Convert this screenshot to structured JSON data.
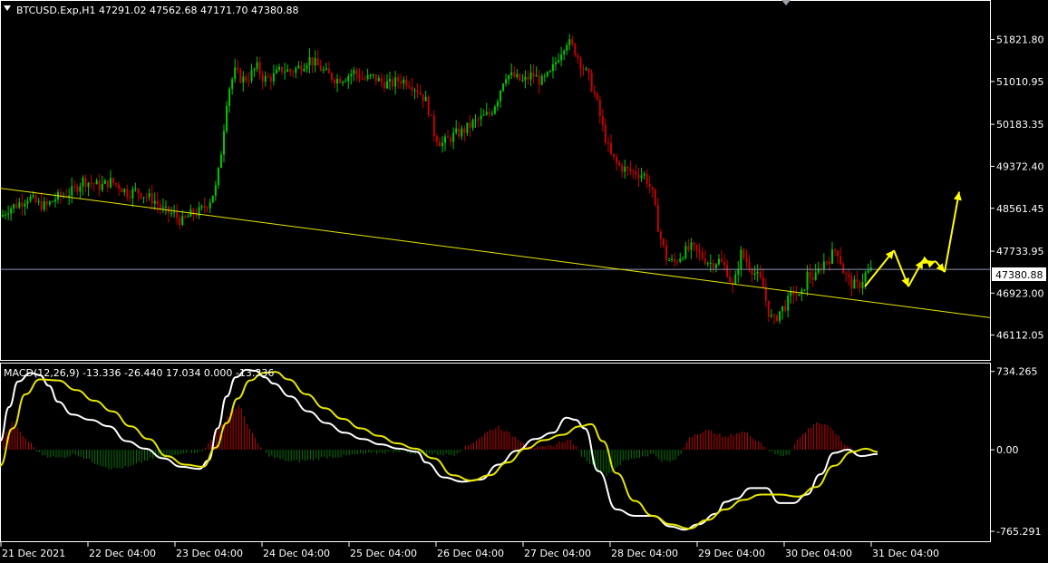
{
  "header": {
    "symbol_line": "BTCUSD.Exp,H1  47291.02 47562.68 47171.70 47380.88",
    "macd_line": "MACD(12,26,9) -13.336 -26.440 17.034 0.000 -13.336"
  },
  "colors": {
    "background": "#000000",
    "frame": "#ffffff",
    "bull_candle": "#00c800",
    "bear_candle": "#c80000",
    "trendline": "#e6e600",
    "forecast_arrow": "#ffff00",
    "price_line": "#8c96b4",
    "macd_line": "#ffffff",
    "signal_line": "#e6e600",
    "hist_pos": "#c80000",
    "hist_neg": "#007800"
  },
  "chart_data": {
    "type": "candlestick",
    "symbol": "BTCUSD.Exp",
    "timeframe": "H1",
    "ohlc_last": {
      "open": 47291.02,
      "high": 47562.68,
      "low": 47171.7,
      "close": 47380.88
    },
    "price_ticks": [
      "51821.80",
      "51010.95",
      "50183.35",
      "49372.40",
      "48561.45",
      "47733.95",
      "46923.00",
      "46112.05"
    ],
    "price_tick_values": [
      51821.8,
      51010.95,
      50183.35,
      49372.4,
      48561.45,
      47733.95,
      46923.0,
      46112.05
    ],
    "current_price_label": "47380.88",
    "current_price": 47380.88,
    "ylim": [
      45650,
      52550
    ],
    "time_labels": [
      "21 Dec 2021",
      "22 Dec 04:00",
      "23 Dec 04:00",
      "24 Dec 04:00",
      "25 Dec 04:00",
      "26 Dec 04:00",
      "27 Dec 04:00",
      "28 Dec 04:00",
      "29 Dec 04:00",
      "30 Dec 04:00",
      "31 Dec 04:00"
    ],
    "price_path": [
      [
        0,
        48400
      ],
      [
        8,
        48550
      ],
      [
        16,
        48620
      ],
      [
        24,
        48700
      ],
      [
        30,
        48780
      ],
      [
        40,
        48650
      ],
      [
        50,
        48600
      ],
      [
        60,
        48750
      ],
      [
        70,
        48820
      ],
      [
        80,
        48900
      ],
      [
        90,
        49100
      ],
      [
        100,
        49050
      ],
      [
        110,
        48980
      ],
      [
        120,
        49080
      ],
      [
        130,
        49000
      ],
      [
        140,
        48850
      ],
      [
        150,
        48900
      ],
      [
        160,
        48800
      ],
      [
        170,
        48700
      ],
      [
        180,
        48500
      ],
      [
        190,
        48450
      ],
      [
        200,
        48300
      ],
      [
        210,
        48450
      ],
      [
        220,
        48500
      ],
      [
        230,
        48700
      ],
      [
        238,
        49000
      ],
      [
        244,
        49800
      ],
      [
        250,
        50800
      ],
      [
        258,
        51200
      ],
      [
        266,
        51050
      ],
      [
        274,
        51100
      ],
      [
        282,
        51300
      ],
      [
        290,
        51050
      ],
      [
        300,
        51100
      ],
      [
        310,
        51250
      ],
      [
        320,
        51200
      ],
      [
        330,
        51300
      ],
      [
        340,
        51450
      ],
      [
        350,
        51300
      ],
      [
        360,
        51150
      ],
      [
        370,
        51050
      ],
      [
        380,
        51100
      ],
      [
        390,
        51200
      ],
      [
        400,
        51050
      ],
      [
        410,
        51100
      ],
      [
        420,
        51000
      ],
      [
        430,
        50950
      ],
      [
        440,
        51050
      ],
      [
        450,
        51000
      ],
      [
        460,
        50850
      ],
      [
        470,
        50600
      ],
      [
        478,
        50000
      ],
      [
        486,
        49800
      ],
      [
        494,
        49900
      ],
      [
        502,
        50000
      ],
      [
        510,
        50050
      ],
      [
        520,
        50200
      ],
      [
        530,
        50300
      ],
      [
        540,
        50400
      ],
      [
        548,
        50700
      ],
      [
        556,
        51150
      ],
      [
        566,
        51100
      ],
      [
        576,
        51000
      ],
      [
        586,
        51150
      ],
      [
        596,
        51000
      ],
      [
        606,
        51150
      ],
      [
        616,
        51550
      ],
      [
        624,
        51800
      ],
      [
        632,
        51650
      ],
      [
        640,
        51350
      ],
      [
        648,
        51100
      ],
      [
        656,
        50700
      ],
      [
        664,
        50100
      ],
      [
        672,
        49600
      ],
      [
        680,
        49400
      ],
      [
        690,
        49300
      ],
      [
        700,
        49250
      ],
      [
        710,
        49200
      ],
      [
        718,
        48900
      ],
      [
        726,
        48100
      ],
      [
        734,
        47600
      ],
      [
        742,
        47500
      ],
      [
        752,
        47700
      ],
      [
        762,
        47800
      ],
      [
        772,
        47650
      ],
      [
        782,
        47500
      ],
      [
        792,
        47550
      ],
      [
        800,
        47400
      ],
      [
        808,
        47000
      ],
      [
        816,
        47700
      ],
      [
        824,
        47500
      ],
      [
        832,
        47300
      ],
      [
        840,
        47100
      ],
      [
        846,
        46600
      ],
      [
        852,
        46350
      ],
      [
        858,
        46550
      ],
      [
        866,
        46700
      ],
      [
        874,
        46950
      ],
      [
        882,
        46800
      ],
      [
        890,
        47300
      ],
      [
        898,
        47200
      ],
      [
        906,
        47500
      ],
      [
        914,
        47600
      ],
      [
        922,
        47800
      ],
      [
        930,
        47300
      ],
      [
        938,
        47100
      ],
      [
        946,
        47050
      ],
      [
        954,
        47300
      ],
      [
        962,
        47380
      ]
    ],
    "trendline": {
      "from": [
        0,
        48950
      ],
      "to": [
        1092,
        46450
      ]
    },
    "forecast_path": [
      [
        954,
        47050
      ],
      [
        986,
        47750
      ],
      [
        1002,
        47050
      ],
      [
        1018,
        47560
      ],
      [
        1026,
        47500
      ],
      [
        1032,
        47540
      ],
      [
        1042,
        47330
      ],
      [
        1058,
        48880
      ]
    ],
    "macd": {
      "label": "MACD(12,26,9)",
      "values": {
        "main": -13.336,
        "signal": -26.44,
        "histogram": 17.034,
        "zero": 0.0,
        "last": -13.336
      },
      "ticks": [
        "734.265",
        "0.00",
        "-765.291"
      ],
      "tick_values": [
        734.265,
        0.0,
        -765.291
      ],
      "ylim": [
        -850,
        800
      ],
      "main": [
        [
          0,
          80
        ],
        [
          10,
          400
        ],
        [
          20,
          640
        ],
        [
          34,
          720
        ],
        [
          44,
          700
        ],
        [
          54,
          600
        ],
        [
          64,
          450
        ],
        [
          80,
          330
        ],
        [
          100,
          280
        ],
        [
          120,
          220
        ],
        [
          140,
          80
        ],
        [
          160,
          10
        ],
        [
          180,
          -80
        ],
        [
          200,
          -160
        ],
        [
          220,
          -180
        ],
        [
          230,
          -100
        ],
        [
          240,
          200
        ],
        [
          250,
          500
        ],
        [
          260,
          680
        ],
        [
          272,
          750
        ],
        [
          282,
          740
        ],
        [
          292,
          680
        ],
        [
          302,
          620
        ],
        [
          320,
          500
        ],
        [
          340,
          360
        ],
        [
          360,
          250
        ],
        [
          380,
          160
        ],
        [
          400,
          100
        ],
        [
          420,
          50
        ],
        [
          440,
          10
        ],
        [
          460,
          -20
        ],
        [
          470,
          -120
        ],
        [
          490,
          -260
        ],
        [
          510,
          -300
        ],
        [
          530,
          -280
        ],
        [
          550,
          -140
        ],
        [
          570,
          -10
        ],
        [
          590,
          100
        ],
        [
          610,
          160
        ],
        [
          625,
          300
        ],
        [
          635,
          280
        ],
        [
          645,
          200
        ],
        [
          660,
          -200
        ],
        [
          680,
          -560
        ],
        [
          700,
          -620
        ],
        [
          720,
          -620
        ],
        [
          740,
          -720
        ],
        [
          755,
          -750
        ],
        [
          770,
          -700
        ],
        [
          790,
          -600
        ],
        [
          800,
          -490
        ],
        [
          812,
          -460
        ],
        [
          828,
          -360
        ],
        [
          845,
          -360
        ],
        [
          860,
          -500
        ],
        [
          875,
          -500
        ],
        [
          890,
          -420
        ],
        [
          905,
          -230
        ],
        [
          920,
          -30
        ],
        [
          935,
          0
        ],
        [
          950,
          -60
        ],
        [
          968,
          -40
        ]
      ],
      "signal": [
        [
          0,
          -150
        ],
        [
          14,
          200
        ],
        [
          28,
          520
        ],
        [
          44,
          660
        ],
        [
          64,
          650
        ],
        [
          84,
          560
        ],
        [
          104,
          460
        ],
        [
          124,
          360
        ],
        [
          144,
          220
        ],
        [
          164,
          100
        ],
        [
          184,
          -60
        ],
        [
          204,
          -140
        ],
        [
          224,
          -160
        ],
        [
          238,
          20
        ],
        [
          250,
          250
        ],
        [
          262,
          480
        ],
        [
          276,
          650
        ],
        [
          290,
          720
        ],
        [
          304,
          730
        ],
        [
          318,
          660
        ],
        [
          338,
          520
        ],
        [
          358,
          390
        ],
        [
          378,
          290
        ],
        [
          398,
          200
        ],
        [
          418,
          130
        ],
        [
          438,
          60
        ],
        [
          458,
          10
        ],
        [
          478,
          -80
        ],
        [
          500,
          -240
        ],
        [
          520,
          -290
        ],
        [
          540,
          -240
        ],
        [
          560,
          -120
        ],
        [
          580,
          10
        ],
        [
          600,
          90
        ],
        [
          620,
          140
        ],
        [
          640,
          220
        ],
        [
          652,
          240
        ],
        [
          665,
          80
        ],
        [
          680,
          -220
        ],
        [
          700,
          -480
        ],
        [
          720,
          -620
        ],
        [
          740,
          -700
        ],
        [
          760,
          -740
        ],
        [
          780,
          -660
        ],
        [
          800,
          -560
        ],
        [
          820,
          -470
        ],
        [
          840,
          -420
        ],
        [
          860,
          -420
        ],
        [
          880,
          -440
        ],
        [
          900,
          -350
        ],
        [
          920,
          -150
        ],
        [
          940,
          -20
        ],
        [
          955,
          10
        ],
        [
          968,
          -20
        ]
      ],
      "histogram": [
        [
          4,
          120
        ],
        [
          14,
          260
        ],
        [
          24,
          140
        ],
        [
          34,
          60
        ],
        [
          44,
          -40
        ],
        [
          64,
          -80
        ],
        [
          84,
          -40
        ],
        [
          104,
          -120
        ],
        [
          124,
          -180
        ],
        [
          144,
          -160
        ],
        [
          164,
          -90
        ],
        [
          184,
          -70
        ],
        [
          204,
          -20
        ],
        [
          214,
          -20
        ],
        [
          224,
          -20
        ],
        [
          234,
          120
        ],
        [
          244,
          220
        ],
        [
          254,
          350
        ],
        [
          264,
          420
        ],
        [
          274,
          220
        ],
        [
          284,
          60
        ],
        [
          294,
          -40
        ],
        [
          304,
          -80
        ],
        [
          320,
          -110
        ],
        [
          340,
          -100
        ],
        [
          360,
          -70
        ],
        [
          380,
          -60
        ],
        [
          400,
          -40
        ],
        [
          420,
          -30
        ],
        [
          440,
          -10
        ],
        [
          460,
          -40
        ],
        [
          480,
          -40
        ],
        [
          500,
          -50
        ],
        [
          520,
          60
        ],
        [
          530,
          120
        ],
        [
          540,
          180
        ],
        [
          550,
          220
        ],
        [
          560,
          160
        ],
        [
          570,
          110
        ],
        [
          580,
          60
        ],
        [
          590,
          20
        ],
        [
          600,
          20
        ],
        [
          610,
          40
        ],
        [
          620,
          80
        ],
        [
          630,
          90
        ],
        [
          640,
          -40
        ],
        [
          650,
          -120
        ],
        [
          660,
          -200
        ],
        [
          670,
          -240
        ],
        [
          680,
          -160
        ],
        [
          690,
          -100
        ],
        [
          700,
          -80
        ],
        [
          710,
          -60
        ],
        [
          720,
          -40
        ],
        [
          730,
          -100
        ],
        [
          740,
          -120
        ],
        [
          750,
          -60
        ],
        [
          760,
          120
        ],
        [
          770,
          160
        ],
        [
          780,
          180
        ],
        [
          790,
          160
        ],
        [
          800,
          110
        ],
        [
          810,
          150
        ],
        [
          820,
          170
        ],
        [
          830,
          120
        ],
        [
          840,
          60
        ],
        [
          850,
          -20
        ],
        [
          860,
          -60
        ],
        [
          870,
          -40
        ],
        [
          880,
          100
        ],
        [
          890,
          180
        ],
        [
          900,
          260
        ],
        [
          910,
          230
        ],
        [
          920,
          180
        ],
        [
          930,
          60
        ],
        [
          940,
          10
        ],
        [
          950,
          -10
        ]
      ]
    }
  }
}
